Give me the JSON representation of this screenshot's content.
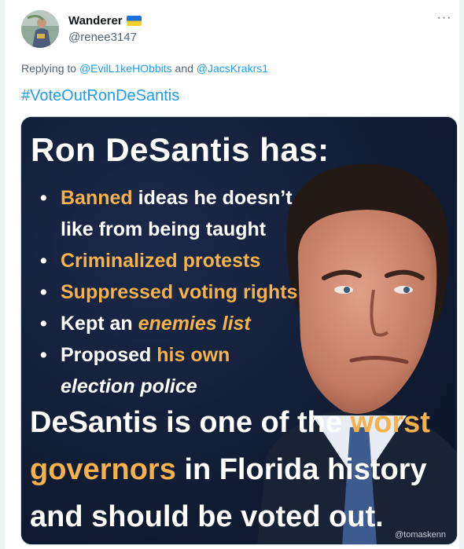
{
  "author": {
    "display_name": "Wanderer",
    "handle": "@renee3147",
    "flag_icon": "ukraine-flag-icon",
    "avatar_icon": "user-avatar"
  },
  "menu": {
    "more_label": "···"
  },
  "reply": {
    "prefix": "Replying to ",
    "user1": "@EvilL1keHObbits",
    "joiner": " and ",
    "user2": "@JacsKrakrs1"
  },
  "hashtag": "#VoteOutRonDeSantis",
  "media": {
    "title": "Ron DeSantis has:",
    "bullet_char": "•",
    "bullets": {
      "b1_highlight": "Banned",
      "b1_rest": " ideas he doesn’t",
      "b1_cont": "like from being taught",
      "b2": "Criminalized protests",
      "b3": "Suppressed voting rights",
      "b4_pre": "Kept an ",
      "b4_em": "enemies list",
      "b5_pre": "Proposed ",
      "b5_highlight": "his own",
      "b5_cont": "election police"
    },
    "line1_pre": "DeSantis is one of the ",
    "line1_highlight": "worst",
    "line2_highlight": "governors",
    "line2_rest": " in Florida history",
    "line3": "and should be voted out.",
    "credit": "@tomaskenn",
    "colors": {
      "highlight": "#f5b14a",
      "background": "#0f1a33",
      "link": "#1d9bf0"
    }
  }
}
